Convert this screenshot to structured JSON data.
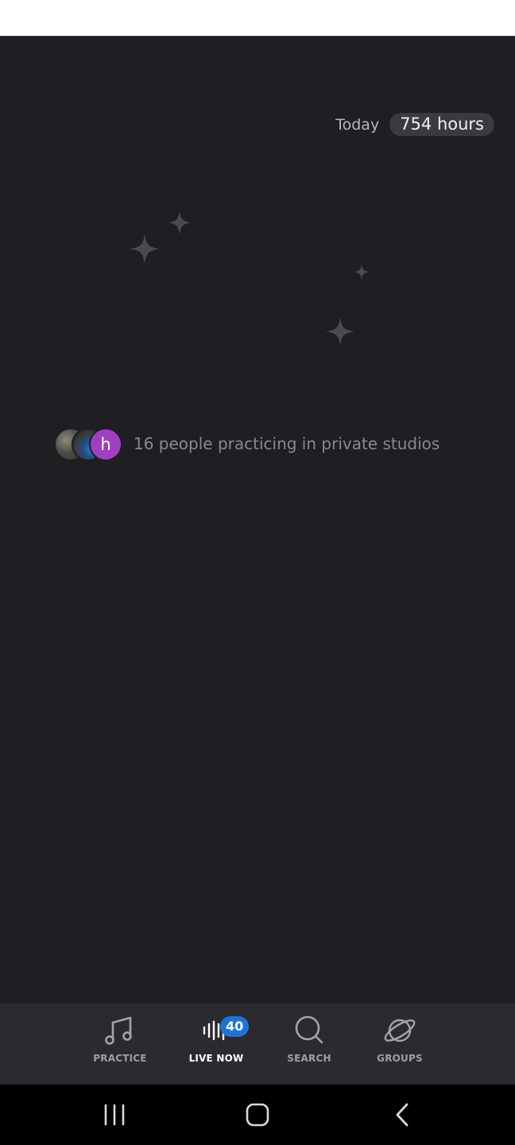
{
  "header": {
    "today_label": "Today",
    "today_hours": "754 hours"
  },
  "presence": {
    "avatars": [
      {
        "type": "photo",
        "icon": "user-photo-avatar"
      },
      {
        "type": "photo",
        "icon": "user-photo-avatar"
      },
      {
        "type": "letter",
        "letter": "h",
        "color": "#a13fc2"
      }
    ],
    "text": "16 people practicing in private studios"
  },
  "tabs": {
    "items": [
      {
        "label": "PRACTICE",
        "icon": "music-note-icon",
        "active": false
      },
      {
        "label": "LIVE NOW",
        "icon": "audio-waveform-icon",
        "active": true,
        "badge": "40"
      },
      {
        "label": "SEARCH",
        "icon": "search-icon",
        "active": false
      },
      {
        "label": "GROUPS",
        "icon": "planet-icon",
        "active": false
      }
    ]
  },
  "system_nav": {
    "buttons": [
      {
        "icon": "recent-apps-icon"
      },
      {
        "icon": "home-icon"
      },
      {
        "icon": "back-icon"
      }
    ]
  },
  "colors": {
    "background": "#1f1e22",
    "tab_bar": "#2b2a2f",
    "badge": "#1e73d6",
    "avatar_letter_bg": "#a13fc2"
  }
}
